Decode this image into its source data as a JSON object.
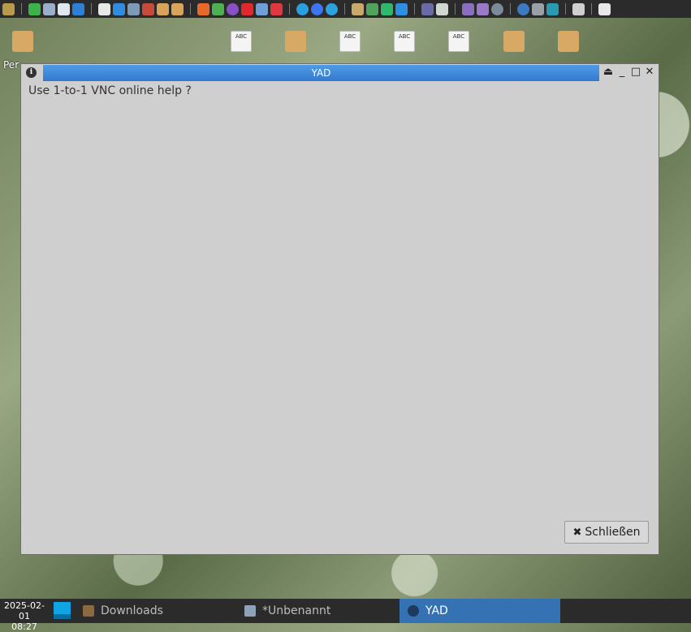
{
  "top_panel": {
    "icons": [
      "app-menu-icon",
      "reload-icon",
      "terminal-icon",
      "editor-icon",
      "writer-icon",
      "search-icon",
      "files-icon",
      "clipboard-icon",
      "tools-icon",
      "home-icon",
      "back-icon",
      "firefox-icon",
      "chameleon-icon",
      "tor-icon",
      "opera-icon",
      "chrome-icon",
      "vivaldi-icon",
      "skype-icon",
      "signal-icon",
      "telegram-icon",
      "image-viewer-icon",
      "game-icon",
      "media-play-icon",
      "vlc-icon",
      "calendar-icon",
      "monitor-icon",
      "microphone-icon",
      "audio-icon",
      "settings-icon",
      "vpn-icon",
      "vnc-icon",
      "vm-icon",
      "screen-icon",
      "volume-icon"
    ]
  },
  "desktop": {
    "labels": [
      "Per"
    ]
  },
  "window": {
    "title": "YAD",
    "message": "Use 1-to-1 VNC online help ?",
    "close_button_label": "Schließen",
    "close_button_glyph": "✖"
  },
  "taskbar": {
    "date": "2025-02-01",
    "time": "08:27",
    "tasks": [
      {
        "label": "Downloads",
        "icon": "folder-icon",
        "active": false
      },
      {
        "label": "*Unbenannt",
        "icon": "editor-icon",
        "active": false
      },
      {
        "label": "YAD",
        "icon": "info-icon",
        "active": true
      }
    ]
  },
  "colors": {
    "accent": "#3479cf",
    "panel": "#2b2b2b",
    "dialog_bg": "#cfcfcf",
    "active_task": "#3572b3"
  }
}
